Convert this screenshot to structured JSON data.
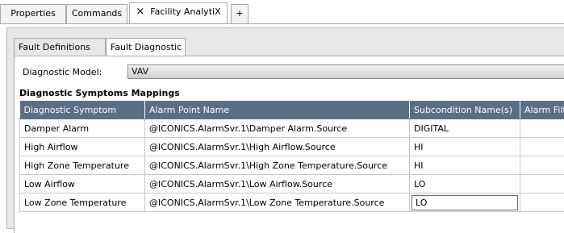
{
  "top_tabs": [
    {
      "label": "Properties"
    },
    {
      "label": "Commands"
    },
    {
      "label": "Facility AnalytiX",
      "close": "×"
    },
    {
      "label": "+"
    }
  ],
  "inner_tabs": [
    {
      "label": "Fault Definitions"
    },
    {
      "label": "Fault Diagnostic"
    }
  ],
  "diagnostic_model": {
    "label": "Diagnostic Model:",
    "value": "VAV"
  },
  "section_title": "Diagnostic Symptoms Mappings",
  "grid": {
    "columns": [
      "Diagnostic Symptom",
      "Alarm Point Name",
      "Subcondition Name(s)",
      "Alarm Filter"
    ],
    "rows": [
      [
        "Damper Alarm",
        "@ICONICS.AlarmSvr.1\\Damper Alarm.Source",
        "DIGITAL",
        ""
      ],
      [
        "High Airflow",
        "@ICONICS.AlarmSvr.1\\High Airflow.Source",
        "HI",
        ""
      ],
      [
        "High Zone Temperature",
        "@ICONICS.AlarmSvr.1\\High Zone Temperature.Source",
        "HI",
        ""
      ],
      [
        "Low Airflow",
        "@ICONICS.AlarmSvr.1\\Low Airflow.Source",
        "LO",
        ""
      ],
      [
        "Low Zone Temperature",
        "@ICONICS.AlarmSvr.1\\Low Zone Temperature.Source",
        "LO",
        ""
      ]
    ]
  }
}
